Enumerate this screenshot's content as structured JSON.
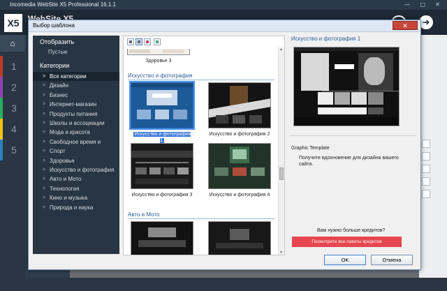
{
  "app": {
    "title": "Incomedia WebSite X5 Professional 16.1.1",
    "brand": "WebSite X5",
    "logo": "X5",
    "window_controls": "—  ▢  ✕",
    "steps": [
      "1",
      "2",
      "3",
      "4",
      "5"
    ],
    "step_colors": [
      "#c0392b",
      "#8e44ad",
      "#27ae60",
      "#f1c40f",
      "#2980b9"
    ],
    "home_icon": "home-icon",
    "next_icon": "arrow-right-icon"
  },
  "dialog": {
    "title": "Выбор шаблона",
    "close_label": "✕",
    "ok_label": "OK",
    "cancel_label": "Отмена"
  },
  "categories": {
    "show_heading": "Отобразить",
    "show_items": [
      "Пустые"
    ],
    "heading": "Категории",
    "items": [
      "Все категории",
      "Дизайн",
      "Бизнес",
      "Интернет-магазин",
      "Продукты питания",
      "Школы и ассоциации",
      "Мода и красота",
      "Свободное время и",
      "Спорт",
      "Здоровье",
      "Искусство и фотография",
      "Авто и Мото",
      "Технология",
      "Кино и музыка",
      "Природа и наука"
    ],
    "selected_index": 0
  },
  "gallery": {
    "view_buttons": [
      "list-view-icon",
      "grid-view-icon",
      "large-view-icon",
      "export-icon"
    ],
    "prev_caption": "Здоровье 3",
    "sections": [
      {
        "title": "Искусство и фотография",
        "items": [
          "Искусство и фотография 1",
          "Искусство и фотография 2",
          "Искусство и фотография 3",
          "Искусство и фотография 4"
        ]
      },
      {
        "title": "Авто и Мото",
        "items": []
      }
    ],
    "selected": "Искусство и фотография 1"
  },
  "preview": {
    "title": "Искусство и фотография 1",
    "kind": "Graphic Template",
    "description": "Получите вдохновение для дизайна вашего сайта.",
    "need_credits": "Вам нужно больше кредитов?",
    "credits_button": "Посмотрите все пакеты кредитов",
    "credits_color": "#e6474f"
  }
}
